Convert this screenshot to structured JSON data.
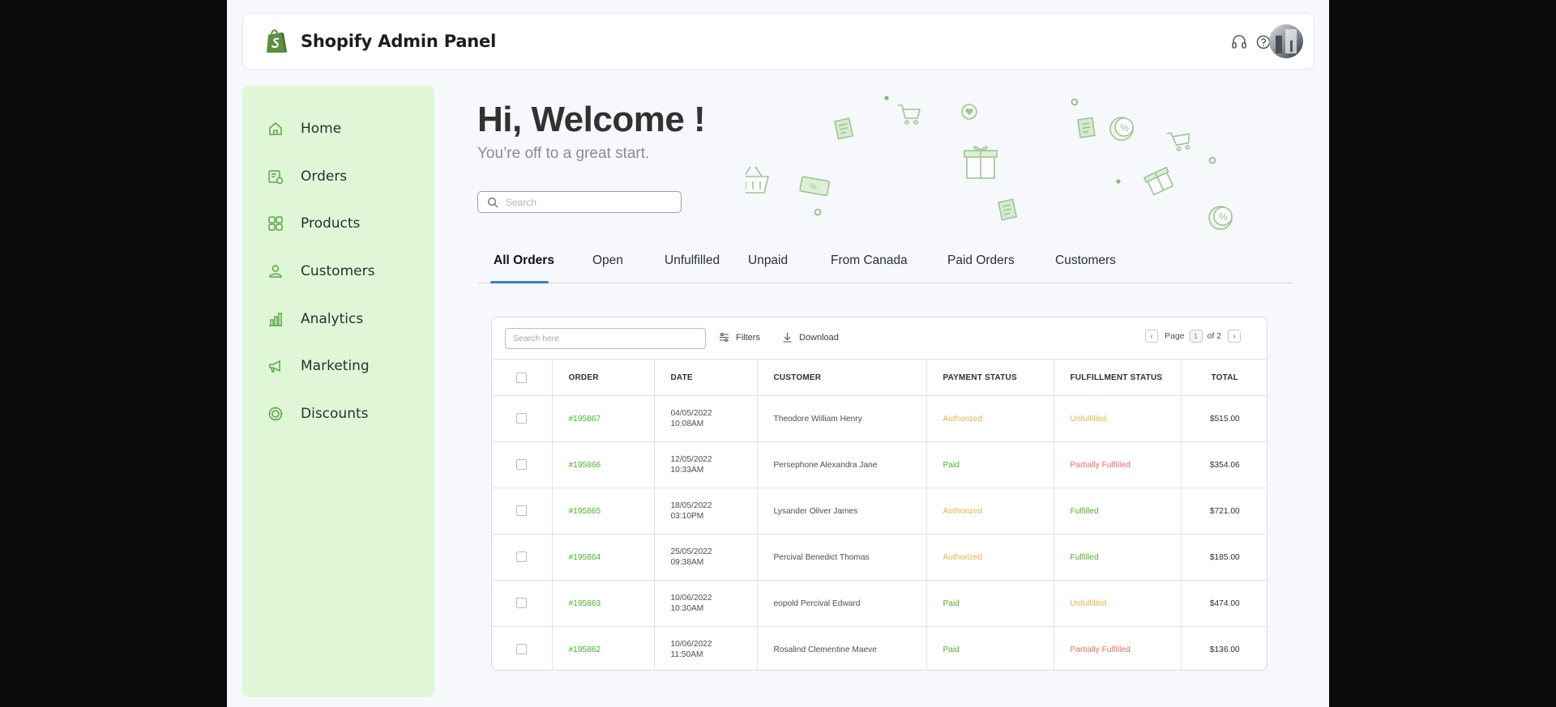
{
  "header": {
    "brand": "Shopify Admin Panel",
    "icons": [
      "headset-icon",
      "help-icon",
      "bell-icon"
    ],
    "accent": "#95bf47",
    "bell_color": "#ef4444"
  },
  "sidebar": {
    "background": "#dff7d6",
    "items": [
      {
        "label": "Home",
        "icon": "home-icon"
      },
      {
        "label": "Orders",
        "icon": "orders-icon"
      },
      {
        "label": "Products",
        "icon": "products-icon"
      },
      {
        "label": "Customers",
        "icon": "customers-icon"
      },
      {
        "label": "Analytics",
        "icon": "analytics-icon"
      },
      {
        "label": "Marketing",
        "icon": "megaphone-icon"
      },
      {
        "label": "Discounts",
        "icon": "discount-badge-icon"
      }
    ]
  },
  "hero": {
    "title": "Hi, Welcome !",
    "subtitle": "You’re off to a great start.",
    "search_placeholder": "Search"
  },
  "tabs": [
    {
      "label": "All Orders",
      "active": true
    },
    {
      "label": "Open"
    },
    {
      "label": "Unfulfilled"
    },
    {
      "label": "Unpaid"
    },
    {
      "label": "From Canada"
    },
    {
      "label": "Paid Orders"
    },
    {
      "label": "Customers"
    }
  ],
  "table": {
    "search_placeholder": "Search here",
    "filters_label": "Filters",
    "download_label": "Download",
    "pager": {
      "label": "Page",
      "current": "1",
      "of": "of 2"
    },
    "columns": [
      "ORDER",
      "DATE",
      "CUSTOMER",
      "PAYMENT STATUS",
      "FULFILLMENT STATUS",
      "TOTAL"
    ],
    "rows": [
      {
        "order": "#195867",
        "date": "04/05/2022",
        "time": "10:08AM",
        "customer": "Theodore William Henry",
        "payment": "Authorized",
        "fulfillment": "Unfulfilled",
        "total": "$515.00"
      },
      {
        "order": "#195866",
        "date": "12/05/2022",
        "time": "10:33AM",
        "customer": "Persephone Alexandra Jane",
        "payment": "Paid",
        "fulfillment": "Partially Fulfilled",
        "total": "$354.06"
      },
      {
        "order": "#195865",
        "date": "18/05/2022",
        "time": "03:10PM",
        "customer": "Lysander Oliver James",
        "payment": "Authorized",
        "fulfillment": "Fulfilled",
        "total": "$721.00"
      },
      {
        "order": "#195864",
        "date": "25/05/2022",
        "time": "09:38AM",
        "customer": "Percival Benedict Thomas",
        "payment": "Authorized",
        "fulfillment": "Fulfilled",
        "total": "$185.00"
      },
      {
        "order": "#195863",
        "date": "10/06/2022",
        "time": "10:30AM",
        "customer": "eopold Percival Edward",
        "payment": "Paid",
        "fulfillment": "Unfulfilled",
        "total": "$474.00"
      },
      {
        "order": "#195862",
        "date": "10/06/2022",
        "time": "11:50AM",
        "customer": "Rosalind Clementine Maeve",
        "payment": "Paid",
        "fulfillment": "Partially Fulfilled",
        "total": "$136.00"
      }
    ],
    "status_colors": {
      "Authorized": "#e6b34a",
      "Paid": "#4caf2c",
      "Unfulfilled": "#e6b34a",
      "Partially Fulfilled": "#ef6a6a",
      "Fulfilled": "#4caf2c"
    }
  }
}
